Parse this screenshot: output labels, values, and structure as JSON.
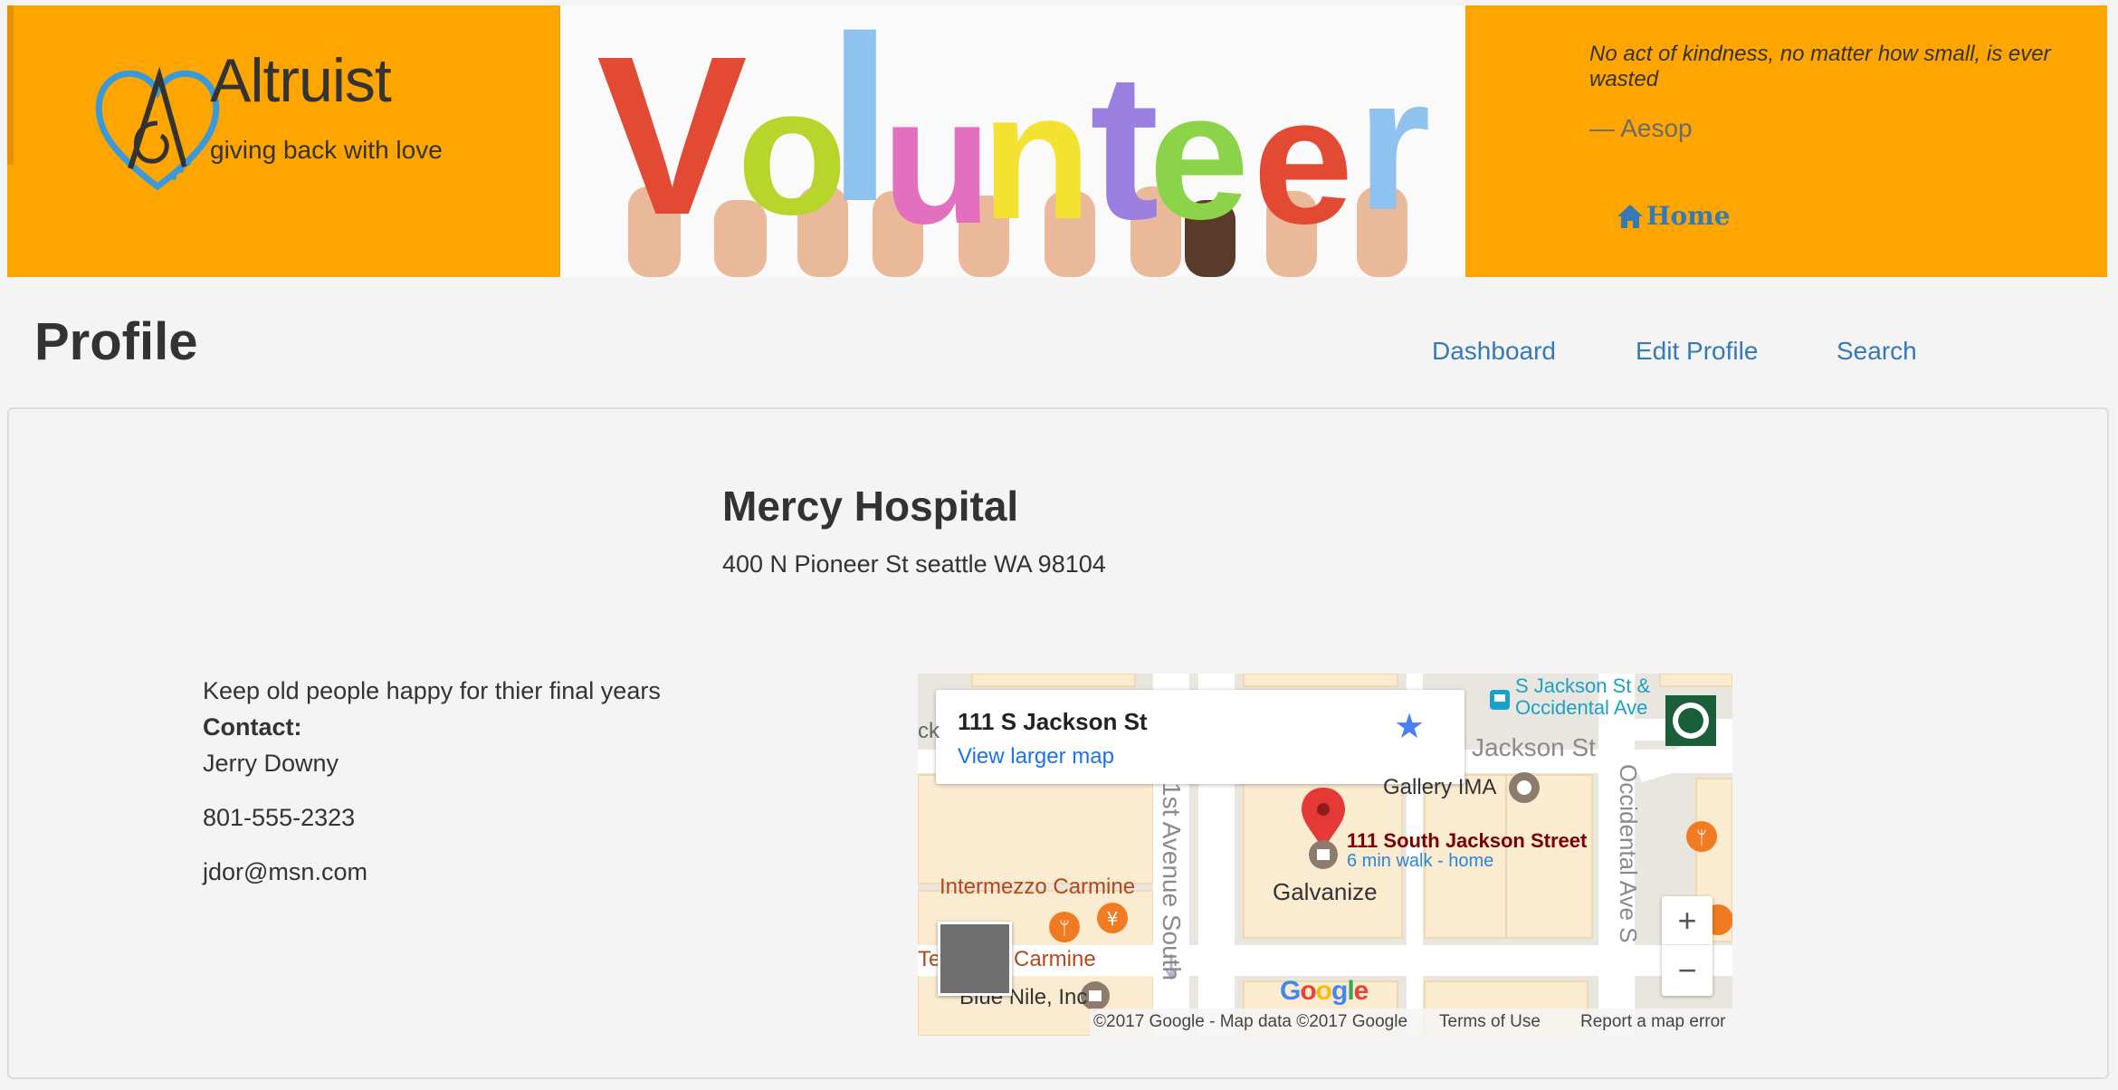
{
  "brand": {
    "name": "Altruist",
    "tagline": "giving back with love"
  },
  "banner": {
    "word_letters": [
      "V",
      "o",
      "l",
      "u",
      "n",
      "t",
      "e",
      "e",
      "r"
    ]
  },
  "quote": {
    "text": "No act of kindness, no matter how small, is ever wasted",
    "author": "— Aesop"
  },
  "home_link": {
    "label": "Home"
  },
  "page": {
    "title": "Profile"
  },
  "nav": {
    "dashboard": "Dashboard",
    "edit_profile": "Edit Profile",
    "search": "Search"
  },
  "org": {
    "name": "Mercy Hospital",
    "address": "400 N Pioneer St seattle WA 98104",
    "description": "Keep old people happy for thier final years",
    "contact_label": "Contact:",
    "contact_name": "Jerry Downy",
    "phone": "801-555-2323",
    "email": "jdor@msn.com"
  },
  "map": {
    "card_title": "111 S Jackson St",
    "card_link": "View larger map",
    "transit_stop": "S Jackson St & Occidental Ave",
    "streets": {
      "jackson": "Jackson St",
      "first_ave": "1st Avenue South",
      "occidental": "Occidental Ave S"
    },
    "places": {
      "gallery": "Gallery IMA",
      "galvanize": "Galvanize",
      "intermezzo": "Intermezzo Carmine",
      "carmine": "Carmine",
      "carmine_prefix": "Te",
      "blue_nile": "Blue Nile, Inc",
      "card_left_fragment": "ck"
    },
    "pin_title": "111 South Jackson Street",
    "pin_subtitle": "6 min walk - home",
    "zoom_in": "+",
    "zoom_out": "−",
    "google": "Google",
    "copyright": "©2017 Google - Map data ©2017 Google",
    "terms": "Terms of Use",
    "report": "Report a map error"
  }
}
